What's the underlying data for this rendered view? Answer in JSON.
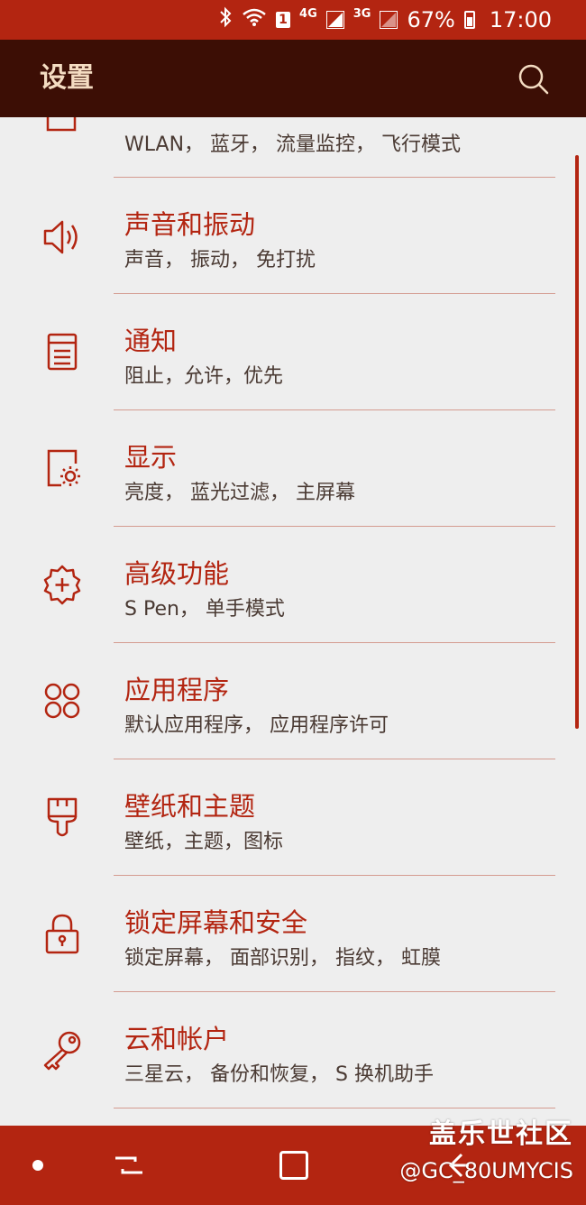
{
  "status_bar": {
    "network_4g": "4G",
    "network_3g": "3G",
    "sim_badge": "1",
    "battery": "67%",
    "time": "17:00"
  },
  "header": {
    "title": "设置"
  },
  "settings": [
    {
      "title": "",
      "subtitle": "WLAN， 蓝牙， 流量监控， 飞行模式",
      "icon": "connections-icon"
    },
    {
      "title": "声音和振动",
      "subtitle": "声音， 振动， 免打扰",
      "icon": "volume-icon"
    },
    {
      "title": "通知",
      "subtitle": "阻止，允许，优先",
      "icon": "notification-icon"
    },
    {
      "title": "显示",
      "subtitle": "亮度， 蓝光过滤， 主屏幕",
      "icon": "display-icon"
    },
    {
      "title": "高级功能",
      "subtitle": "S Pen， 单手模式",
      "icon": "advanced-gear-icon"
    },
    {
      "title": "应用程序",
      "subtitle": "默认应用程序， 应用程序许可",
      "icon": "apps-icon"
    },
    {
      "title": "壁纸和主题",
      "subtitle": "壁纸，主题，图标",
      "icon": "paintbrush-icon"
    },
    {
      "title": "锁定屏幕和安全",
      "subtitle": "锁定屏幕， 面部识别， 指纹， 虹膜",
      "icon": "lock-icon"
    },
    {
      "title": "云和帐户",
      "subtitle": "三星云， 备份和恢复， S 换机助手",
      "icon": "key-icon"
    }
  ],
  "watermark": {
    "line1": "盖乐世社区",
    "line2": "@GC_80UMYCIS"
  },
  "colors": {
    "accent": "#b32511",
    "header_bg": "#3c0e05",
    "header_text": "#f4dcc2",
    "list_bg": "#eeeeee"
  }
}
